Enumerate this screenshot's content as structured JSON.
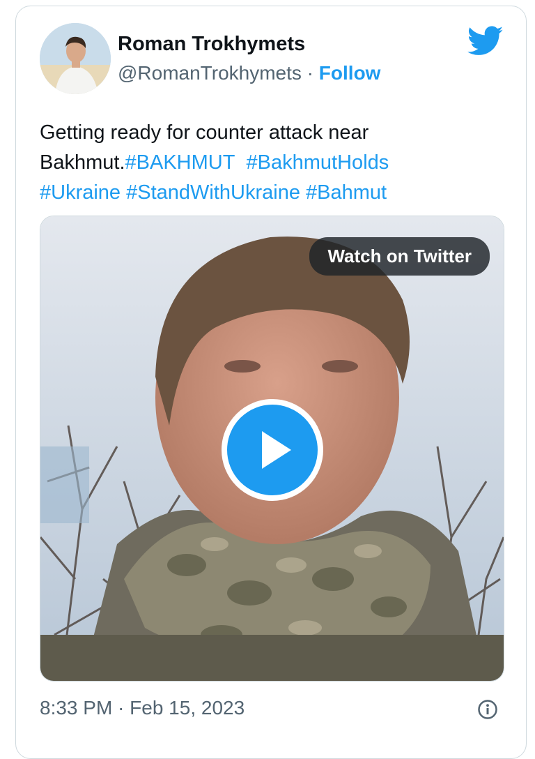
{
  "tweet": {
    "author_name": "Roman Trokhymets",
    "handle": "@RomanTrokhymets",
    "separator": " · ",
    "follow_label": "Follow",
    "text_plain_1": "Getting ready for counter attack near",
    "text_plain_2": "Bakhmut.",
    "hashtags": [
      "#BAKHMUT",
      "#BakhmutHolds",
      "#Ukraine",
      "#StandWithUkraine",
      "#Bahmut"
    ],
    "timestamp": "8:33 PM · Feb 15, 2023"
  },
  "media": {
    "watch_label": "Watch on Twitter",
    "type": "video"
  },
  "icons": {
    "brand": "twitter-bird-icon",
    "play": "play-icon",
    "info": "info-icon"
  },
  "colors": {
    "accent": "#1d9bf0",
    "text": "#0f1419",
    "secondary": "#536471",
    "border": "#cfd9de"
  }
}
